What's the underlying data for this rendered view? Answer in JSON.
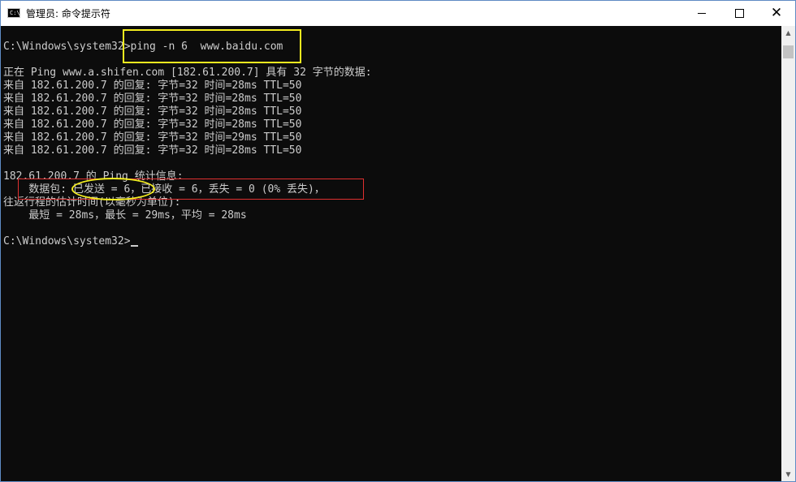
{
  "window": {
    "title": "管理员: 命令提示符",
    "icon_text": "C:\\",
    "icon": "console-icon",
    "controls": {
      "minimize_icon": "minimize-icon",
      "maximize_icon": "maximize-icon",
      "close_icon": "close-icon",
      "close_glyph": "✕"
    }
  },
  "console": {
    "background": "#0c0c0c",
    "text_color": "#cccccc",
    "lines": [
      "C:\\Windows\\system32>ping -n 6  www.baidu.com",
      "",
      "正在 Ping www.a.shifen.com [182.61.200.7] 具有 32 字节的数据:",
      "来自 182.61.200.7 的回复: 字节=32 时间=28ms TTL=50",
      "来自 182.61.200.7 的回复: 字节=32 时间=28ms TTL=50",
      "来自 182.61.200.7 的回复: 字节=32 时间=28ms TTL=50",
      "来自 182.61.200.7 的回复: 字节=32 时间=28ms TTL=50",
      "来自 182.61.200.7 的回复: 字节=32 时间=29ms TTL=50",
      "来自 182.61.200.7 的回复: 字节=32 时间=28ms TTL=50",
      "",
      "182.61.200.7 的 Ping 统计信息:",
      "    数据包: 已发送 = 6，已接收 = 6，丢失 = 0 (0% 丢失)，",
      "往返行程的估计时间(以毫秒为单位):",
      "    最短 = 28ms，最长 = 29ms，平均 = 28ms",
      "",
      "C:\\Windows\\system32>"
    ]
  },
  "annotations": {
    "yellow": "#f5ee1f",
    "red": "#e03030"
  },
  "scrollbar": {
    "up_glyph": "▲",
    "down_glyph": "▼"
  }
}
